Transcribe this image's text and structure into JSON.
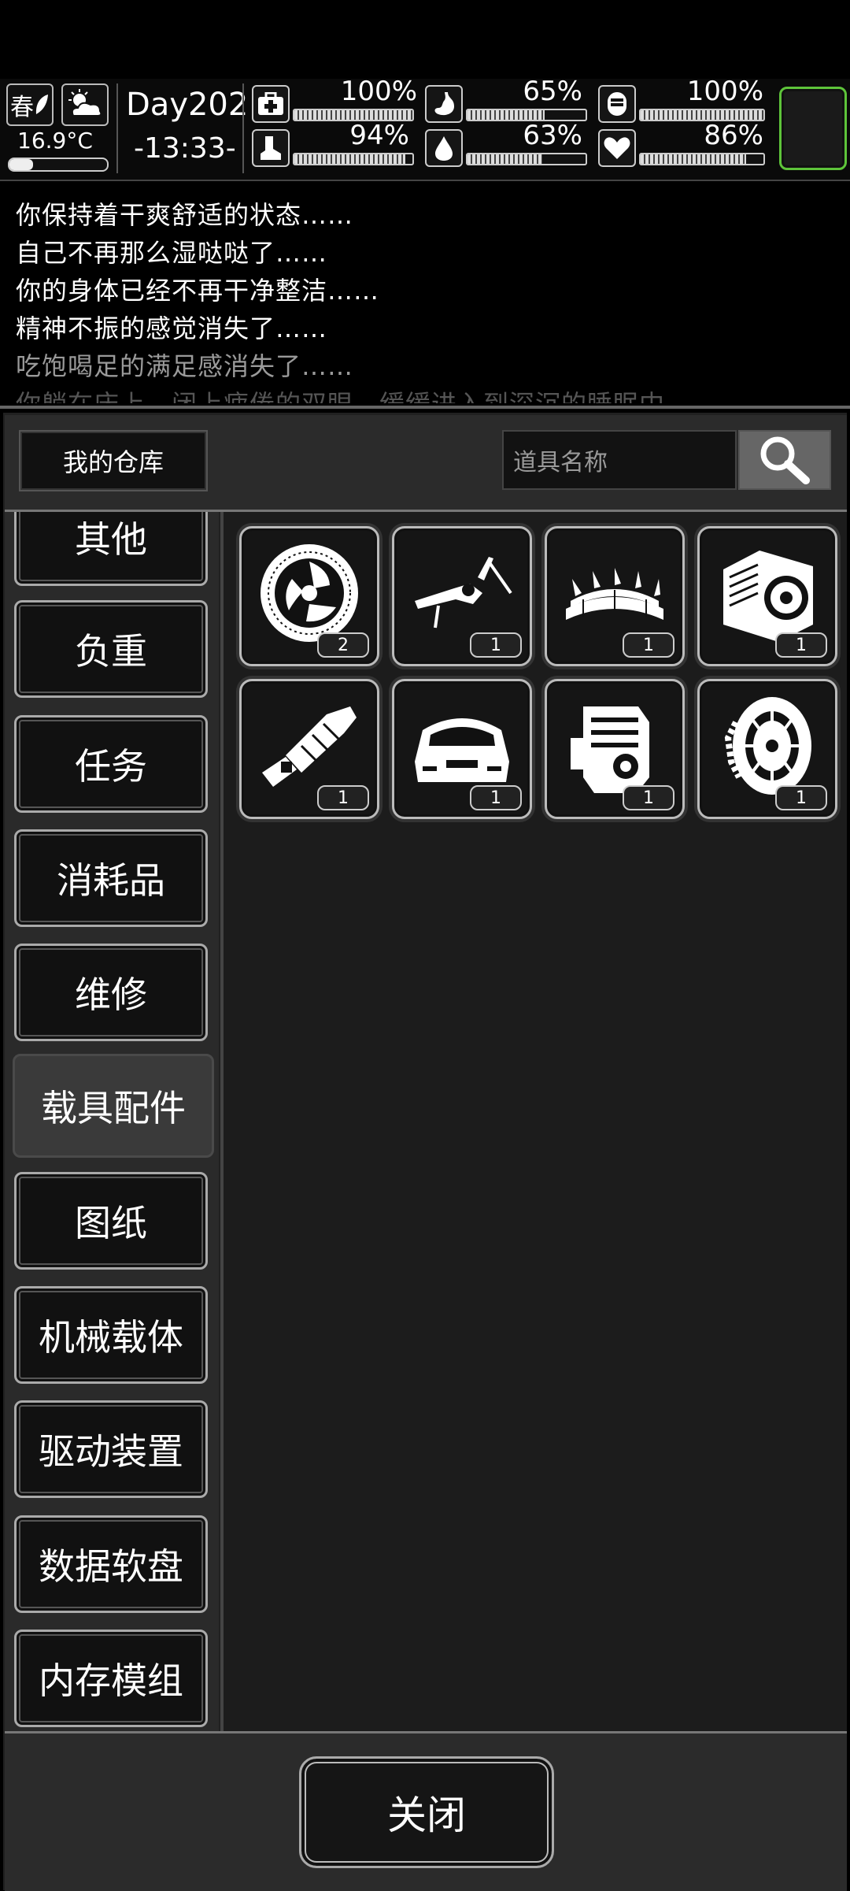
{
  "status": {
    "season": "春",
    "temperature": "16.9°C",
    "day": "Day202",
    "time": "-13:33-",
    "stats": [
      {
        "icon": "medkit-icon",
        "value": "100%",
        "level": 1.0
      },
      {
        "icon": "stomach-icon",
        "value": "65%",
        "level": 0.65
      },
      {
        "icon": "bladder-icon",
        "value": "100%",
        "level": 1.0
      },
      {
        "icon": "boot-icon",
        "value": "94%",
        "level": 0.94
      },
      {
        "icon": "water-drop-icon",
        "value": "63%",
        "level": 0.63
      },
      {
        "icon": "heart-icon",
        "value": "86%",
        "level": 0.86
      }
    ]
  },
  "log": [
    "你保持着干爽舒适的状态……",
    "自己不再那么湿哒哒了……",
    "你的身体已经不再干净整洁……",
    "精神不振的感觉消失了……",
    "吃饱喝足的满足感消失了……",
    "你躺在床上，闭上疲倦的双眼，缓缓进入到深沉的睡眠中……"
  ],
  "panel": {
    "title": "我的仓库",
    "search_placeholder": "道具名称",
    "categories": [
      "其他",
      "负重",
      "任务",
      "消耗品",
      "维修",
      "载具配件",
      "图纸",
      "机械载体",
      "驱动装置",
      "数据软盘",
      "内存模组"
    ],
    "active_category": "载具配件",
    "items": [
      {
        "icon": "brake-disc-icon",
        "count": "2"
      },
      {
        "icon": "wiper-arm-icon",
        "count": "1"
      },
      {
        "icon": "spiked-bar-icon",
        "count": "1"
      },
      {
        "icon": "engine-block-icon",
        "count": "1"
      },
      {
        "icon": "exhaust-pipe-icon",
        "count": "1"
      },
      {
        "icon": "car-trunk-icon",
        "count": "1"
      },
      {
        "icon": "engine-icon",
        "count": "1"
      },
      {
        "icon": "chained-tire-icon",
        "count": "1"
      }
    ],
    "close_label": "关闭"
  }
}
